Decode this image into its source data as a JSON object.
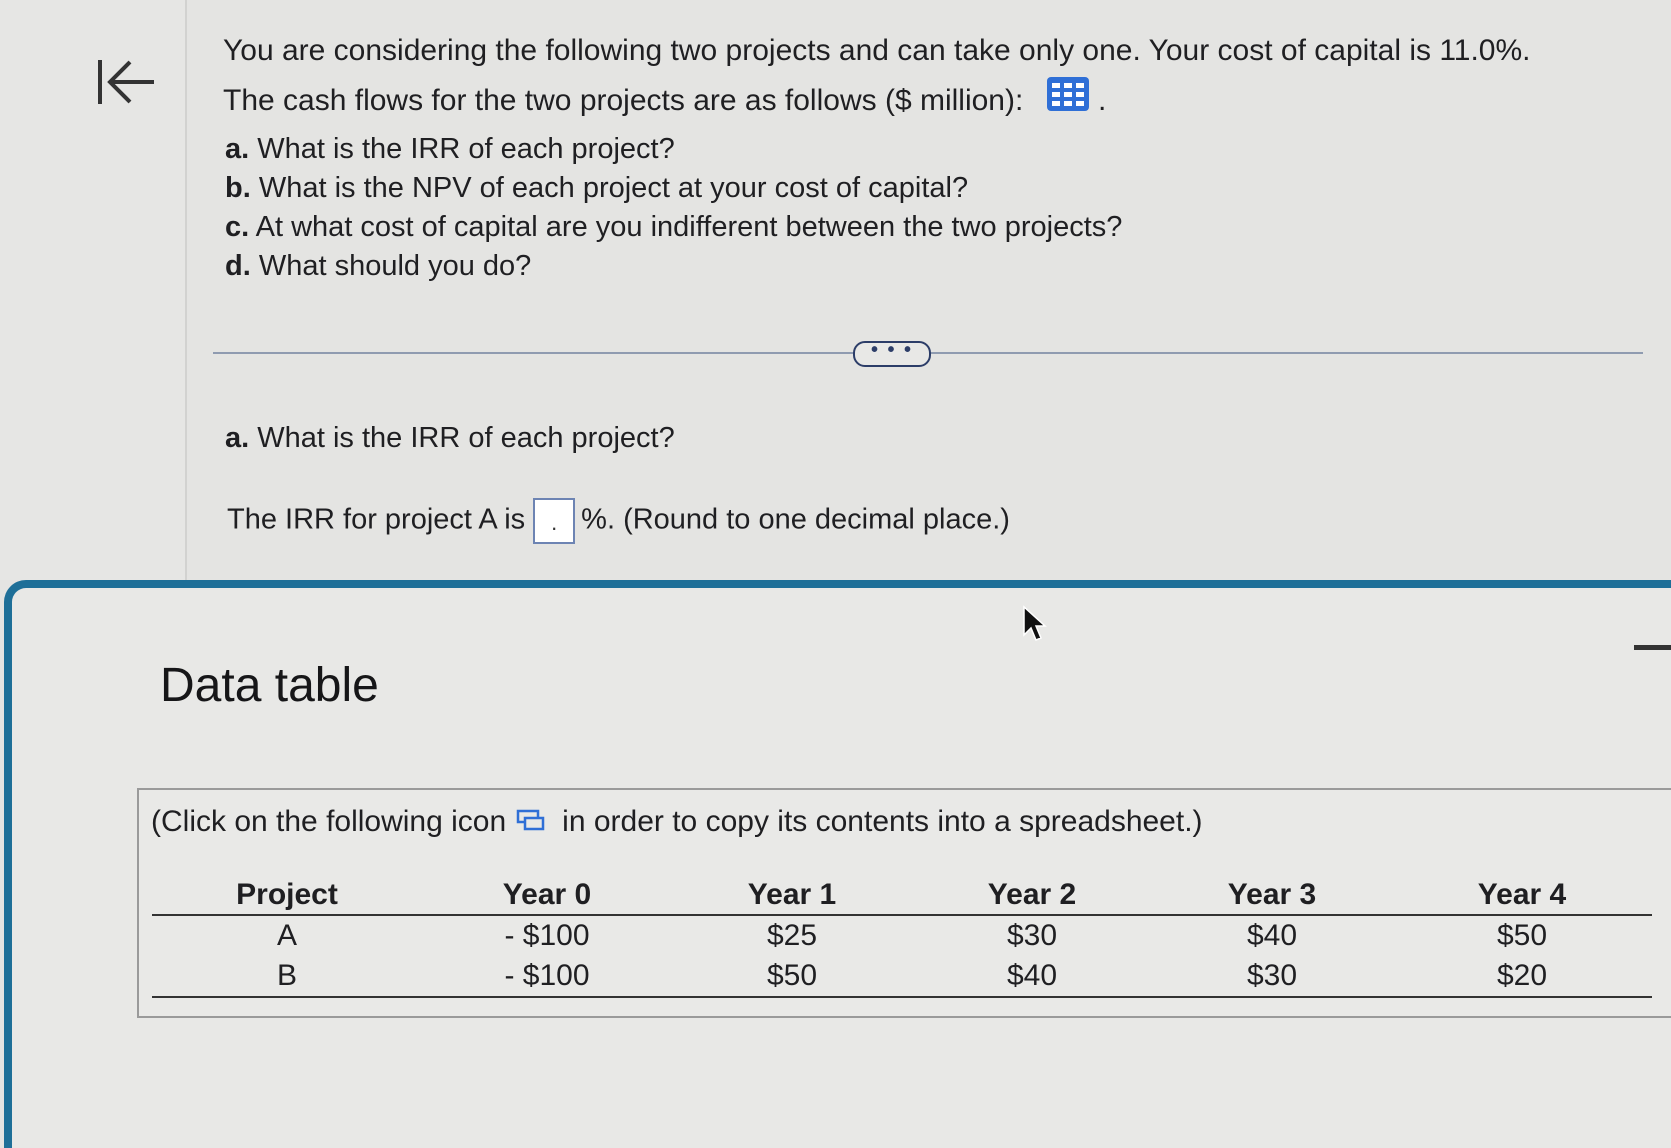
{
  "question": {
    "line1": "You are considering the following two projects and can take only one. Your cost of capital is 11.0%.",
    "line2": "The cash flows for the two projects are as follows ($ million):",
    "line2_suffix": ".",
    "parts": [
      {
        "letter": "a.",
        "text": "What is the IRR of each project?"
      },
      {
        "letter": "b.",
        "text": "What is the NPV of each project at your cost of capital?"
      },
      {
        "letter": "c.",
        "text": "At what cost of capital are you indifferent between the two projects?"
      },
      {
        "letter": "d.",
        "text": "What should you do?"
      }
    ]
  },
  "more_button_label": "• • •",
  "part_a": {
    "letter": "a.",
    "text": "What is the IRR of each project?",
    "irr_prefix": "The IRR for project A is",
    "irr_input_placeholder": ".",
    "irr_suffix": "%. (Round to one decimal place.)"
  },
  "data_table": {
    "title": "Data table",
    "note_prefix": "(Click on the following icon",
    "note_suffix": "in order to copy its contents into a spreadsheet.)",
    "headers": [
      "Project",
      "Year 0",
      "Year 1",
      "Year 2",
      "Year 3",
      "Year 4"
    ],
    "rows": [
      [
        "A",
        "- $100",
        "$25",
        "$30",
        "$40",
        "$50"
      ],
      [
        "B",
        "- $100",
        "$50",
        "$40",
        "$30",
        "$20"
      ]
    ]
  },
  "icons": {
    "back": "collapse-left-arrow-icon",
    "grid": "data-table-grid-icon",
    "copy": "copy-to-spreadsheet-icon"
  },
  "colors": {
    "accent": "#1e6f98",
    "grid_icon": "#2f6fd6",
    "divider": "#8f9bb0"
  }
}
